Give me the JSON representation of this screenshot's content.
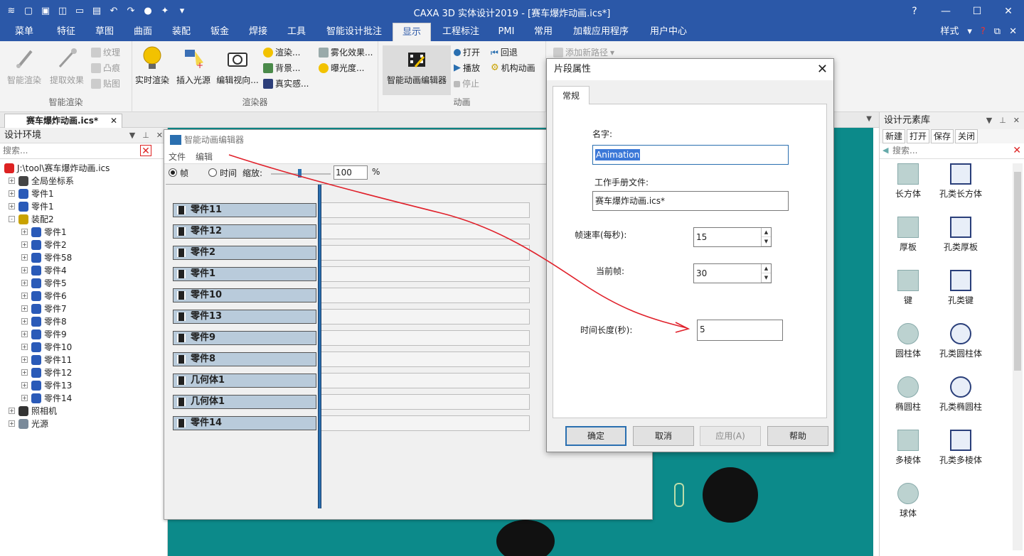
{
  "window": {
    "title": "CAXA 3D 实体设计2019 - [赛车爆炸动画.ics*]"
  },
  "menu": {
    "tabs": [
      "菜单",
      "特征",
      "草图",
      "曲面",
      "装配",
      "钣金",
      "焊接",
      "工具",
      "智能设计批注",
      "显示",
      "工程标注",
      "PMI",
      "常用",
      "加载应用程序",
      "用户中心"
    ],
    "active": "显示",
    "style_label": "样式"
  },
  "ribbon": {
    "group1": {
      "name": "智能渲染",
      "smart_render": "智能渲染",
      "extract_effect": "提取效果",
      "texture": "纹理",
      "bump": "凸痕",
      "decal": "贴图"
    },
    "group2": {
      "name": "渲染器",
      "realtime": "实时渲染",
      "insert_light": "插入光源",
      "edit_view": "编辑视向...",
      "render": "渲染...",
      "background": "背景...",
      "realism": "真实感...",
      "fog": "雾化效果...",
      "exposure": "曝光度..."
    },
    "group3": {
      "name": "动画",
      "anim_editor": "智能动画编辑器",
      "open": "打开",
      "play": "播放",
      "stop": "停止",
      "rewind": "回退",
      "mechanism": "机构动画",
      "add_path": "添加新路径"
    }
  },
  "doc_tab": {
    "label": "赛车爆炸动画.ics*"
  },
  "left_panel": {
    "title": "设计环境",
    "search_placeholder": "搜索...",
    "tree": [
      {
        "label": "J:\\tool\\赛车爆炸动画.ics",
        "level": 0,
        "exp": ""
      },
      {
        "label": "全局坐标系",
        "level": 1,
        "exp": "+"
      },
      {
        "label": "零件1",
        "level": 1,
        "exp": "+"
      },
      {
        "label": "零件1",
        "level": 1,
        "exp": "+"
      },
      {
        "label": "装配2",
        "level": 1,
        "exp": "-"
      },
      {
        "label": "零件1",
        "level": 2,
        "exp": "+"
      },
      {
        "label": "零件2",
        "level": 2,
        "exp": "+"
      },
      {
        "label": "零件58",
        "level": 2,
        "exp": "+"
      },
      {
        "label": "零件4",
        "level": 2,
        "exp": "+"
      },
      {
        "label": "零件5",
        "level": 2,
        "exp": "+"
      },
      {
        "label": "零件6",
        "level": 2,
        "exp": "+"
      },
      {
        "label": "零件7",
        "level": 2,
        "exp": "+"
      },
      {
        "label": "零件8",
        "level": 2,
        "exp": "+"
      },
      {
        "label": "零件9",
        "level": 2,
        "exp": "+"
      },
      {
        "label": "零件10",
        "level": 2,
        "exp": "+"
      },
      {
        "label": "零件11",
        "level": 2,
        "exp": "+"
      },
      {
        "label": "零件12",
        "level": 2,
        "exp": "+"
      },
      {
        "label": "零件13",
        "level": 2,
        "exp": "+"
      },
      {
        "label": "零件14",
        "level": 2,
        "exp": "+"
      },
      {
        "label": "照相机",
        "level": 1,
        "exp": "+"
      },
      {
        "label": "光源",
        "level": 1,
        "exp": "+"
      }
    ]
  },
  "anim_editor": {
    "title": "智能动画编辑器",
    "menu_file": "文件",
    "menu_edit": "编辑",
    "radio_frame": "帧",
    "radio_time": "时间",
    "zoom_label": "缩放:",
    "zoom_value": "100",
    "zoom_unit": "%",
    "clips": [
      "零件11",
      "零件12",
      "零件2",
      "零件1",
      "零件10",
      "零件13",
      "零件9",
      "零件8",
      "几何体1",
      "几何体1",
      "零件14"
    ]
  },
  "dialog": {
    "title": "片段属性",
    "tab": "常规",
    "name_label": "名字:",
    "name_value": "Animation",
    "manual_label": "工作手册文件:",
    "manual_value": "赛车爆炸动画.ics*",
    "fps_label": "帧速率(每秒):",
    "fps_value": "15",
    "cur_frame_label": "当前帧:",
    "cur_frame_value": "30",
    "duration_label": "时间长度(秒):",
    "duration_value": "5",
    "ok": "确定",
    "cancel": "取消",
    "apply": "应用(A)",
    "help": "帮助"
  },
  "right_panel": {
    "title": "设计元素库",
    "new": "新建",
    "open": "打开",
    "save": "保存",
    "close": "关闭",
    "search_placeholder": "搜索...",
    "items": [
      "长方体",
      "孔类长方体",
      "厚板",
      "孔类厚板",
      "键",
      "孔类键",
      "圆柱体",
      "孔类圆柱体",
      "椭圆柱",
      "孔类椭圆柱",
      "多棱体",
      "孔类多棱体",
      "球体"
    ]
  },
  "colors": {
    "title_blue": "#2b58a8",
    "viewport": "#0c8a8a",
    "clip_fill": "#b9cbdb",
    "annotation": "#e0202a"
  }
}
